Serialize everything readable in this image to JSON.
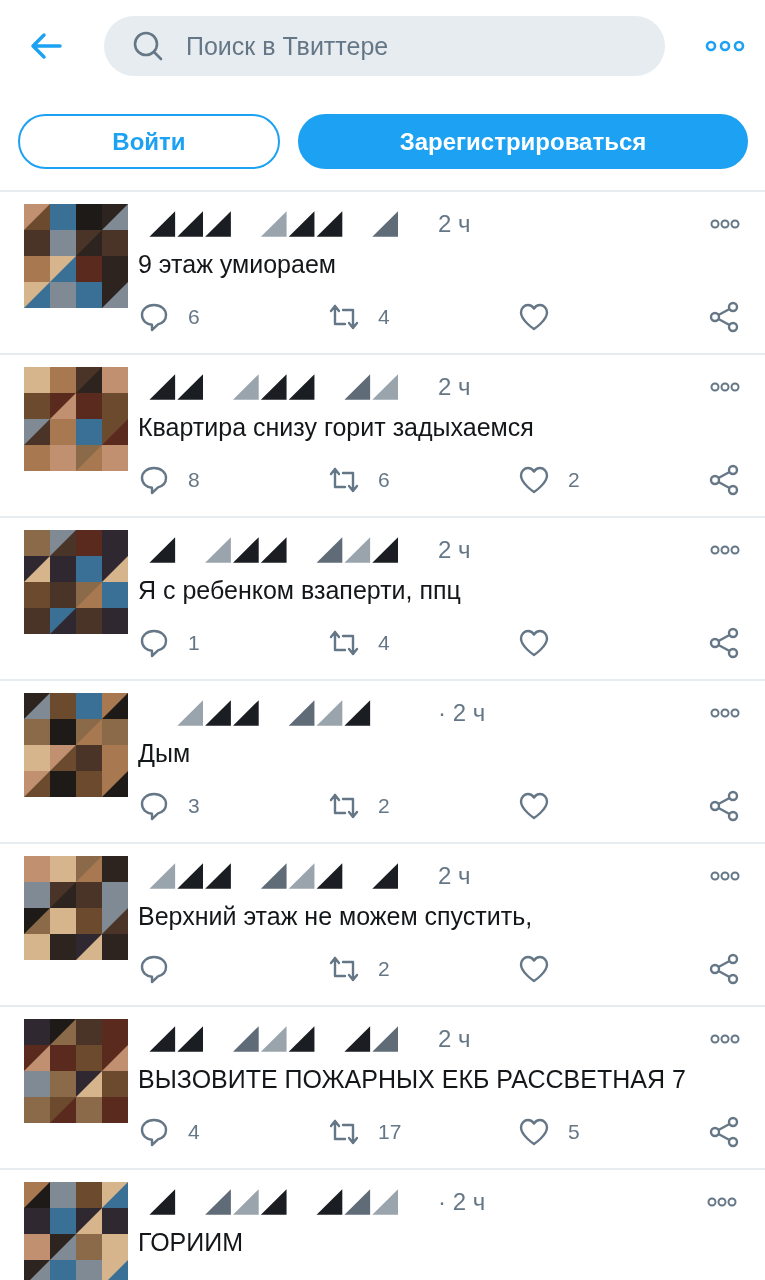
{
  "header": {
    "search": {
      "placeholder": "Поиск в Твиттере"
    }
  },
  "auth_buttons": {
    "login": "Войти",
    "signup": "Зарегистрироваться"
  },
  "tweets": [
    {
      "time": "2 ч",
      "text": "9 этаж умиораем",
      "actions": {
        "replies": "6",
        "retweets": "4"
      }
    },
    {
      "time": "2 ч",
      "text": "Квартира снизу горит задыхаемся",
      "actions": {
        "replies": "8",
        "retweets": "6",
        "likes": "2"
      }
    },
    {
      "time": "2 ч",
      "text": "Я с ребенком взаперти, ппц",
      "actions": {
        "replies": "1",
        "retweets": "4"
      }
    },
    {
      "time": "· 2 ч",
      "text": "Дым",
      "actions": {
        "replies": "3",
        "retweets": "2"
      }
    },
    {
      "time": "2 ч",
      "text": "Верхний этаж не можем спустить,",
      "actions": {
        "retweets": "2"
      }
    },
    {
      "time": "2 ч",
      "text": "ВЫЗОВИТЕ ПОЖАРНЫХ ЕКБ РАССВЕТНАЯ 7",
      "actions": {
        "replies": "4",
        "retweets": "17",
        "likes": "5"
      }
    },
    {
      "time": "· 2 ч",
      "text": "ГОРИИМ"
    }
  ]
}
